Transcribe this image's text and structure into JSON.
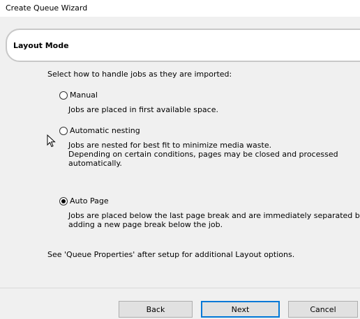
{
  "window": {
    "title": "Create Queue Wizard"
  },
  "header": {
    "title": "Layout Mode"
  },
  "main": {
    "instruction": "Select how to handle jobs as they are imported:",
    "options": [
      {
        "label": "Manual",
        "selected": false,
        "description": [
          "Jobs are placed in first available space."
        ]
      },
      {
        "label": "Automatic nesting",
        "selected": false,
        "description": [
          "Jobs are nested for best fit to minimize media waste.",
          "Depending on certain conditions, pages may be closed and processed",
          "automatically."
        ]
      },
      {
        "label": "Auto Page",
        "selected": true,
        "description": [
          "Jobs are placed below the last page break and are immediately separated by",
          "adding a new page break below the job."
        ]
      }
    ],
    "footnote": "See 'Queue Properties' after setup for additional Layout options."
  },
  "buttons": {
    "back": "Back",
    "next": "Next",
    "cancel": "Cancel"
  },
  "colors": {
    "focus_accent": "#0078d7",
    "dialog_background": "#f0f0f0"
  }
}
